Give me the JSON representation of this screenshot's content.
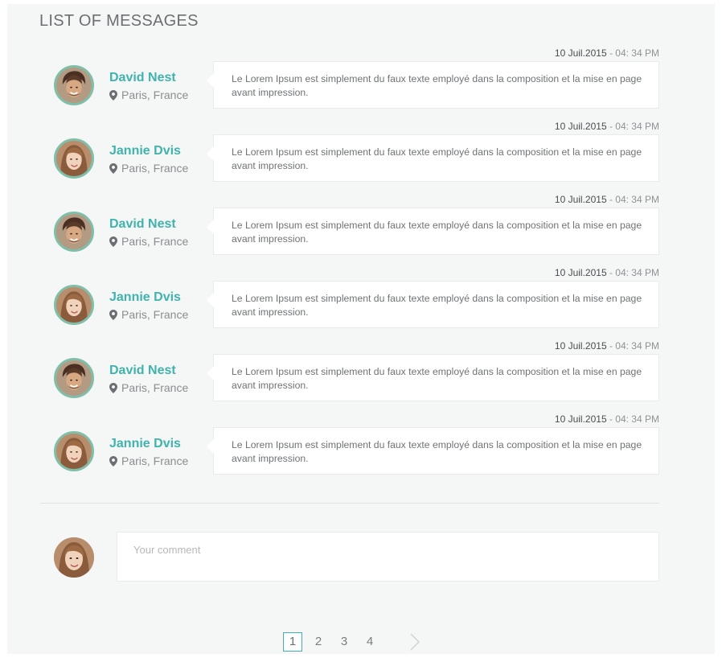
{
  "header": {
    "title": "LIST OF MESSAGES"
  },
  "messages": [
    {
      "date": "10 Juil.2015",
      "time": " - 04: 34 PM",
      "name": "David Nest",
      "location": "Paris, France",
      "text": "Le Lorem Ipsum est simplement du faux texte employé dans la composition et la mise en page avant impression.",
      "avatar": "male-avatar"
    },
    {
      "date": "10 Juil.2015",
      "time": " - 04: 34 PM",
      "name": "Jannie Dvis",
      "location": "Paris, France",
      "text": "Le Lorem Ipsum est simplement du faux texte employé dans la composition et la mise en page avant impression.",
      "avatar": "female-avatar"
    },
    {
      "date": "10 Juil.2015",
      "time": " - 04: 34 PM",
      "name": "David Nest",
      "location": "Paris, France",
      "text": "Le Lorem Ipsum est simplement du faux texte employé dans la composition et la mise en page avant impression.",
      "avatar": "male-avatar"
    },
    {
      "date": "10 Juil.2015",
      "time": " - 04: 34 PM",
      "name": "Jannie Dvis",
      "location": "Paris, France",
      "text": "Le Lorem Ipsum est simplement du faux texte employé dans la composition et la mise en page avant impression.",
      "avatar": "female-avatar"
    },
    {
      "date": "10 Juil.2015",
      "time": " - 04: 34 PM",
      "name": "David Nest",
      "location": "Paris, France",
      "text": "Le Lorem Ipsum est simplement du faux texte employé dans la composition et la mise en page avant impression.",
      "avatar": "male-avatar"
    },
    {
      "date": "10 Juil.2015",
      "time": " - 04: 34 PM",
      "name": "Jannie Dvis",
      "location": "Paris, France",
      "text": "Le Lorem Ipsum est simplement du faux texte employé dans la composition et la mise en page avant impression.",
      "avatar": "female-avatar"
    }
  ],
  "comment": {
    "placeholder": "Your comment",
    "value": "",
    "avatar": "female-avatar"
  },
  "pagination": {
    "pages": [
      "1",
      "2",
      "3",
      "4"
    ],
    "active": "1",
    "next_icon": "chevron-right-icon"
  },
  "colors": {
    "accent": "#3fb3ac",
    "avatar_ring": "#7fbfa9",
    "background": "#f5f6f6"
  }
}
